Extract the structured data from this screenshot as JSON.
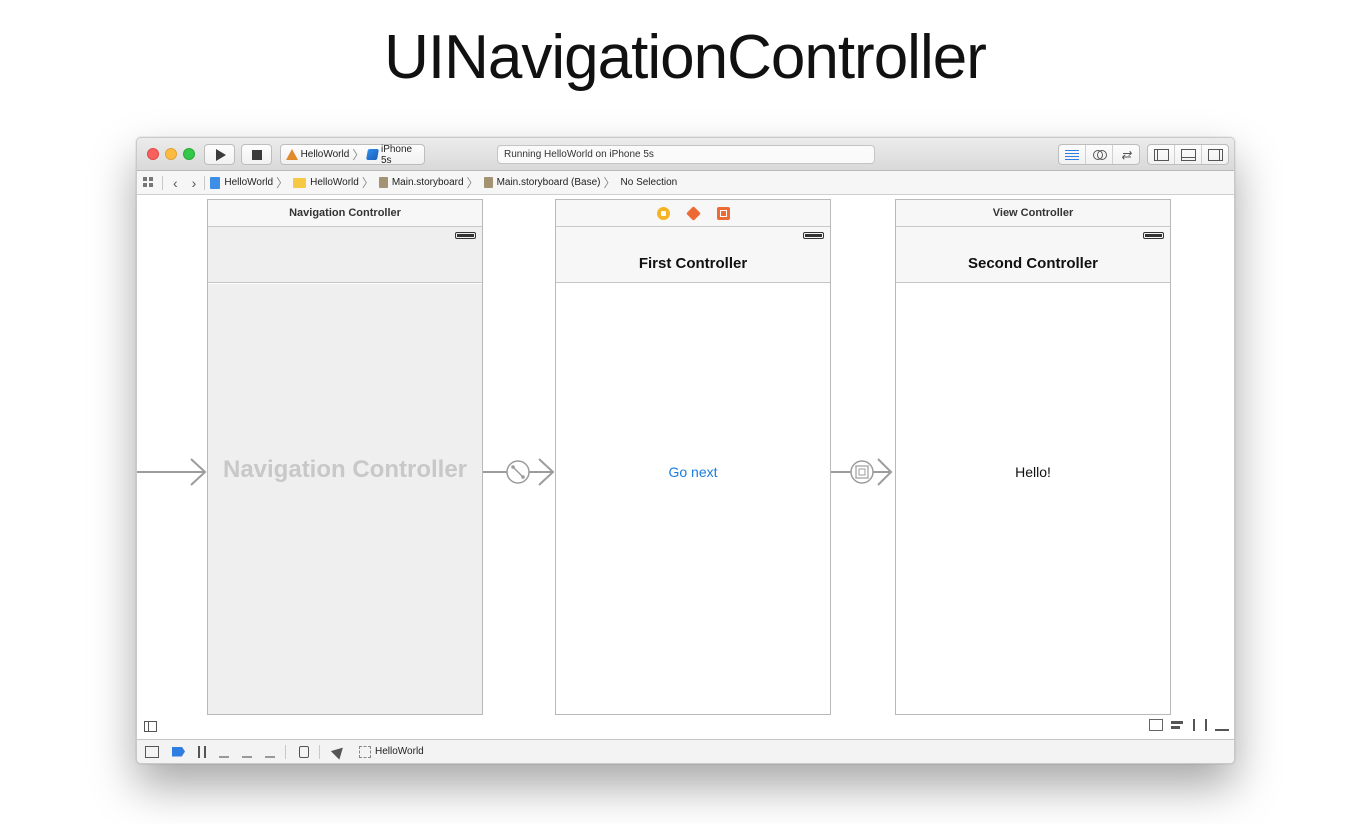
{
  "title": "UINavigationController",
  "toolbar": {
    "scheme_app": "HelloWorld",
    "scheme_device": "iPhone 5s",
    "status": "Running HelloWorld on iPhone 5s"
  },
  "jumpbar": {
    "crumbs": [
      "HelloWorld",
      "HelloWorld",
      "Main.storyboard",
      "Main.storyboard (Base)",
      "No Selection"
    ]
  },
  "scenes": {
    "navigation": {
      "header": "Navigation Controller",
      "placeholder": "Navigation Controller"
    },
    "first": {
      "nav_title": "First Controller",
      "button_label": "Go next"
    },
    "second": {
      "header": "View Controller",
      "nav_title": "Second Controller",
      "label": "Hello!"
    }
  },
  "debugbar": {
    "target": "HelloWorld"
  },
  "colors": {
    "accent_blue": "#1a7de0",
    "close": "#fc605c",
    "minimize": "#fdbc40",
    "maximize": "#34c84a"
  }
}
